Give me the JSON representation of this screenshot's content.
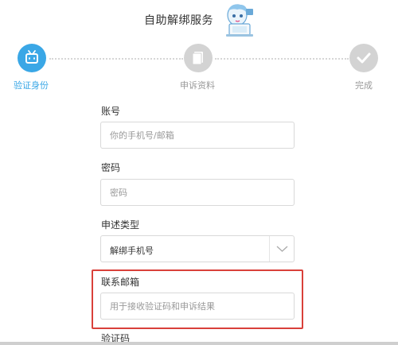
{
  "header": {
    "title": "自助解绑服务"
  },
  "steps": [
    {
      "label": "验证身份",
      "state": "active"
    },
    {
      "label": "申诉资料",
      "state": "inactive"
    },
    {
      "label": "完成",
      "state": "inactive"
    }
  ],
  "form": {
    "account": {
      "label": "账号",
      "placeholder": "你的手机号/邮箱"
    },
    "password": {
      "label": "密码",
      "placeholder": "密码"
    },
    "complaint_type": {
      "label": "申述类型",
      "value": "解绑手机号"
    },
    "contact_email": {
      "label": "联系邮箱",
      "placeholder": "用于接收验证码和申诉结果"
    },
    "verification_code": {
      "label": "验证码"
    }
  },
  "colors": {
    "accent": "#3aa7e6",
    "inactive": "#d3d3d3",
    "highlight": "#d9403a"
  }
}
